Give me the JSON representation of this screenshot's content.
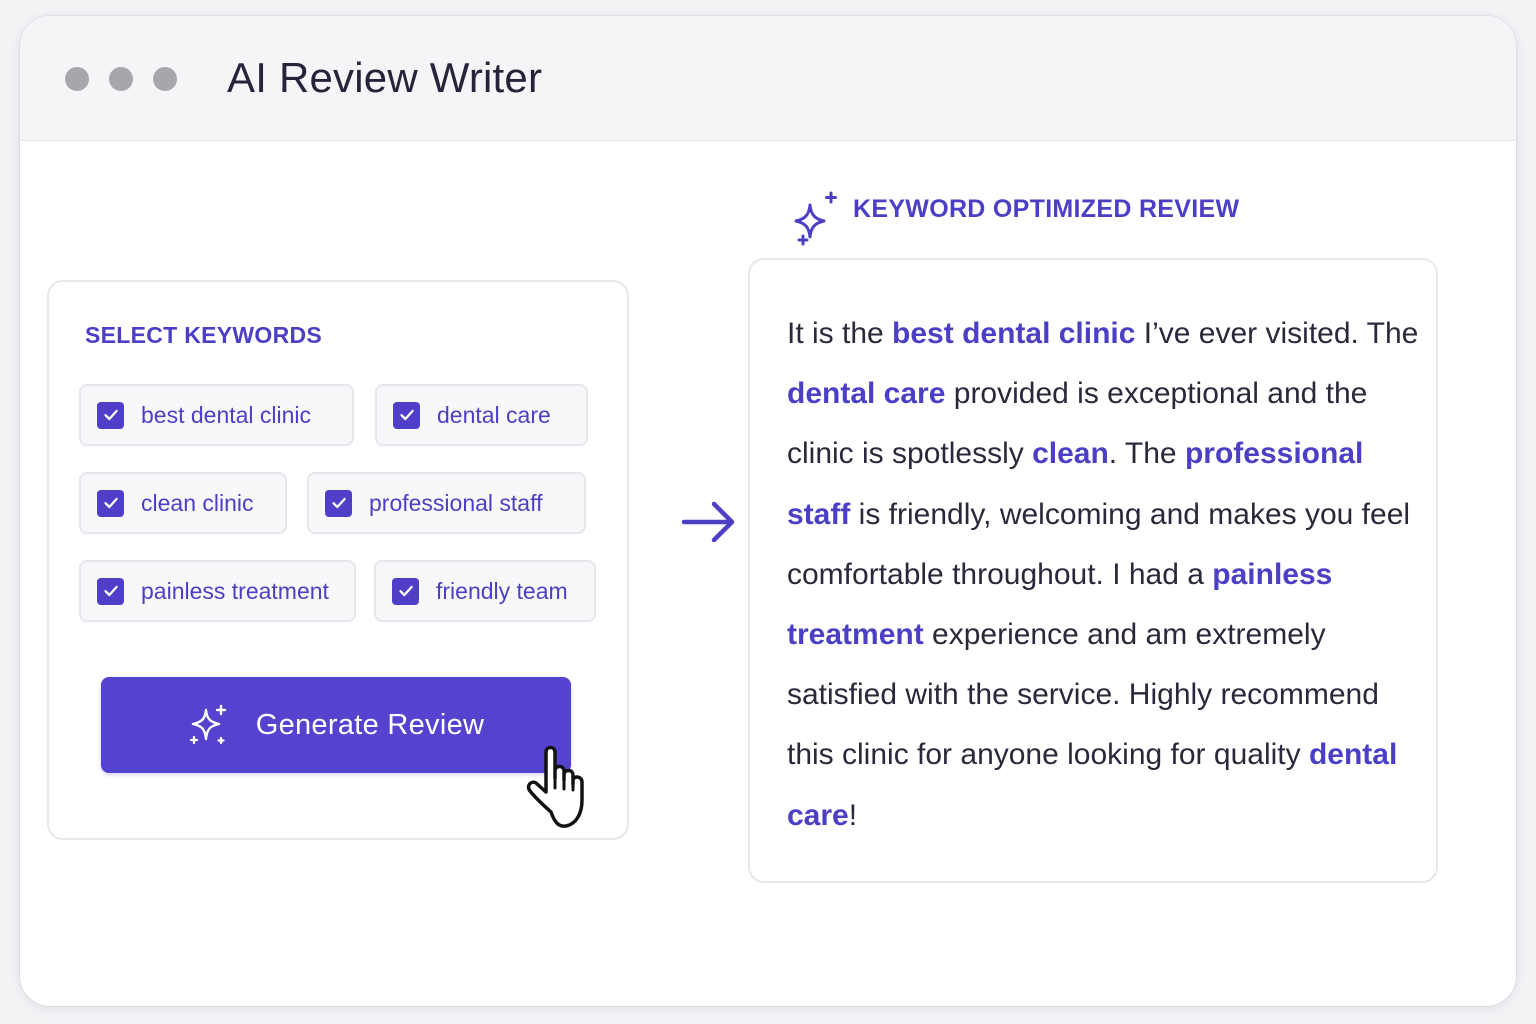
{
  "window": {
    "title": "AI Review Writer"
  },
  "keywords_panel": {
    "heading": "SELECT KEYWORDS",
    "keywords": [
      {
        "label": "best dental clinic",
        "checked": true
      },
      {
        "label": "dental care",
        "checked": true
      },
      {
        "label": "clean clinic",
        "checked": true
      },
      {
        "label": "professional staff",
        "checked": true
      },
      {
        "label": "painless treatment",
        "checked": true
      },
      {
        "label": "friendly team",
        "checked": true
      }
    ],
    "generate_button_label": "Generate Review",
    "generate_button_icon": "sparkles-icon"
  },
  "review_panel": {
    "heading": "KEYWORD OPTIMIZED REVIEW",
    "heading_icon": "sparkles-icon",
    "segments": [
      {
        "text": "It is the ",
        "keyword": false
      },
      {
        "text": "best dental clinic",
        "keyword": true
      },
      {
        "text": " I’ve ever visited. The ",
        "keyword": false
      },
      {
        "text": "dental care",
        "keyword": true
      },
      {
        "text": " provided is exceptional and the clinic is spotlessly ",
        "keyword": false
      },
      {
        "text": "clean",
        "keyword": true
      },
      {
        "text": ". The ",
        "keyword": false
      },
      {
        "text": "professional staff",
        "keyword": true
      },
      {
        "text": " is friendly, welcoming and makes you feel comfortable throughout. I had a ",
        "keyword": false
      },
      {
        "text": "painless treatment",
        "keyword": true
      },
      {
        "text": " experience and am extremely satisfied with the service. Highly recommend this clinic for anyone looking for quality ",
        "keyword": false
      },
      {
        "text": "dental care",
        "keyword": true
      },
      {
        "text": "!",
        "keyword": false
      }
    ]
  },
  "colors": {
    "accent": "#4b3fc6",
    "button": "#5443cf",
    "text": "#2a293c",
    "titlebar": "#f5f5f8"
  }
}
